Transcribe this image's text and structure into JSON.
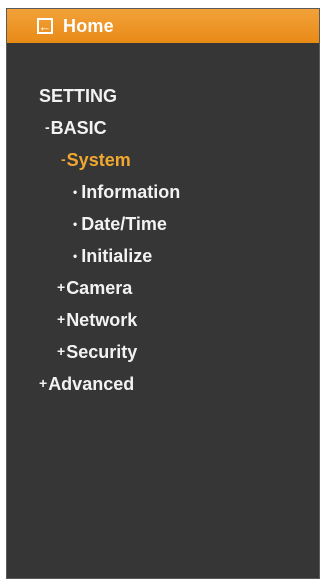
{
  "header": {
    "home_label": "Home"
  },
  "menu": {
    "setting": "SETTING",
    "basic": {
      "prefix": "-",
      "label": "BASIC"
    },
    "system": {
      "prefix": "-",
      "label": "System"
    },
    "system_items": [
      {
        "bullet": "•",
        "label": "Information"
      },
      {
        "bullet": "•",
        "label": "Date/Time"
      },
      {
        "bullet": "•",
        "label": "Initialize"
      }
    ],
    "camera": {
      "prefix": "+",
      "label": "Camera"
    },
    "network": {
      "prefix": "+",
      "label": "Network"
    },
    "security": {
      "prefix": "+",
      "label": "Security"
    },
    "advanced": {
      "prefix": "+",
      "label": "Advanced"
    }
  },
  "colors": {
    "header": "#e88a16",
    "panel": "#363636",
    "text": "#f2f2f2",
    "active": "#f0a830"
  },
  "icons": {
    "home": "back-arrow-icon"
  }
}
